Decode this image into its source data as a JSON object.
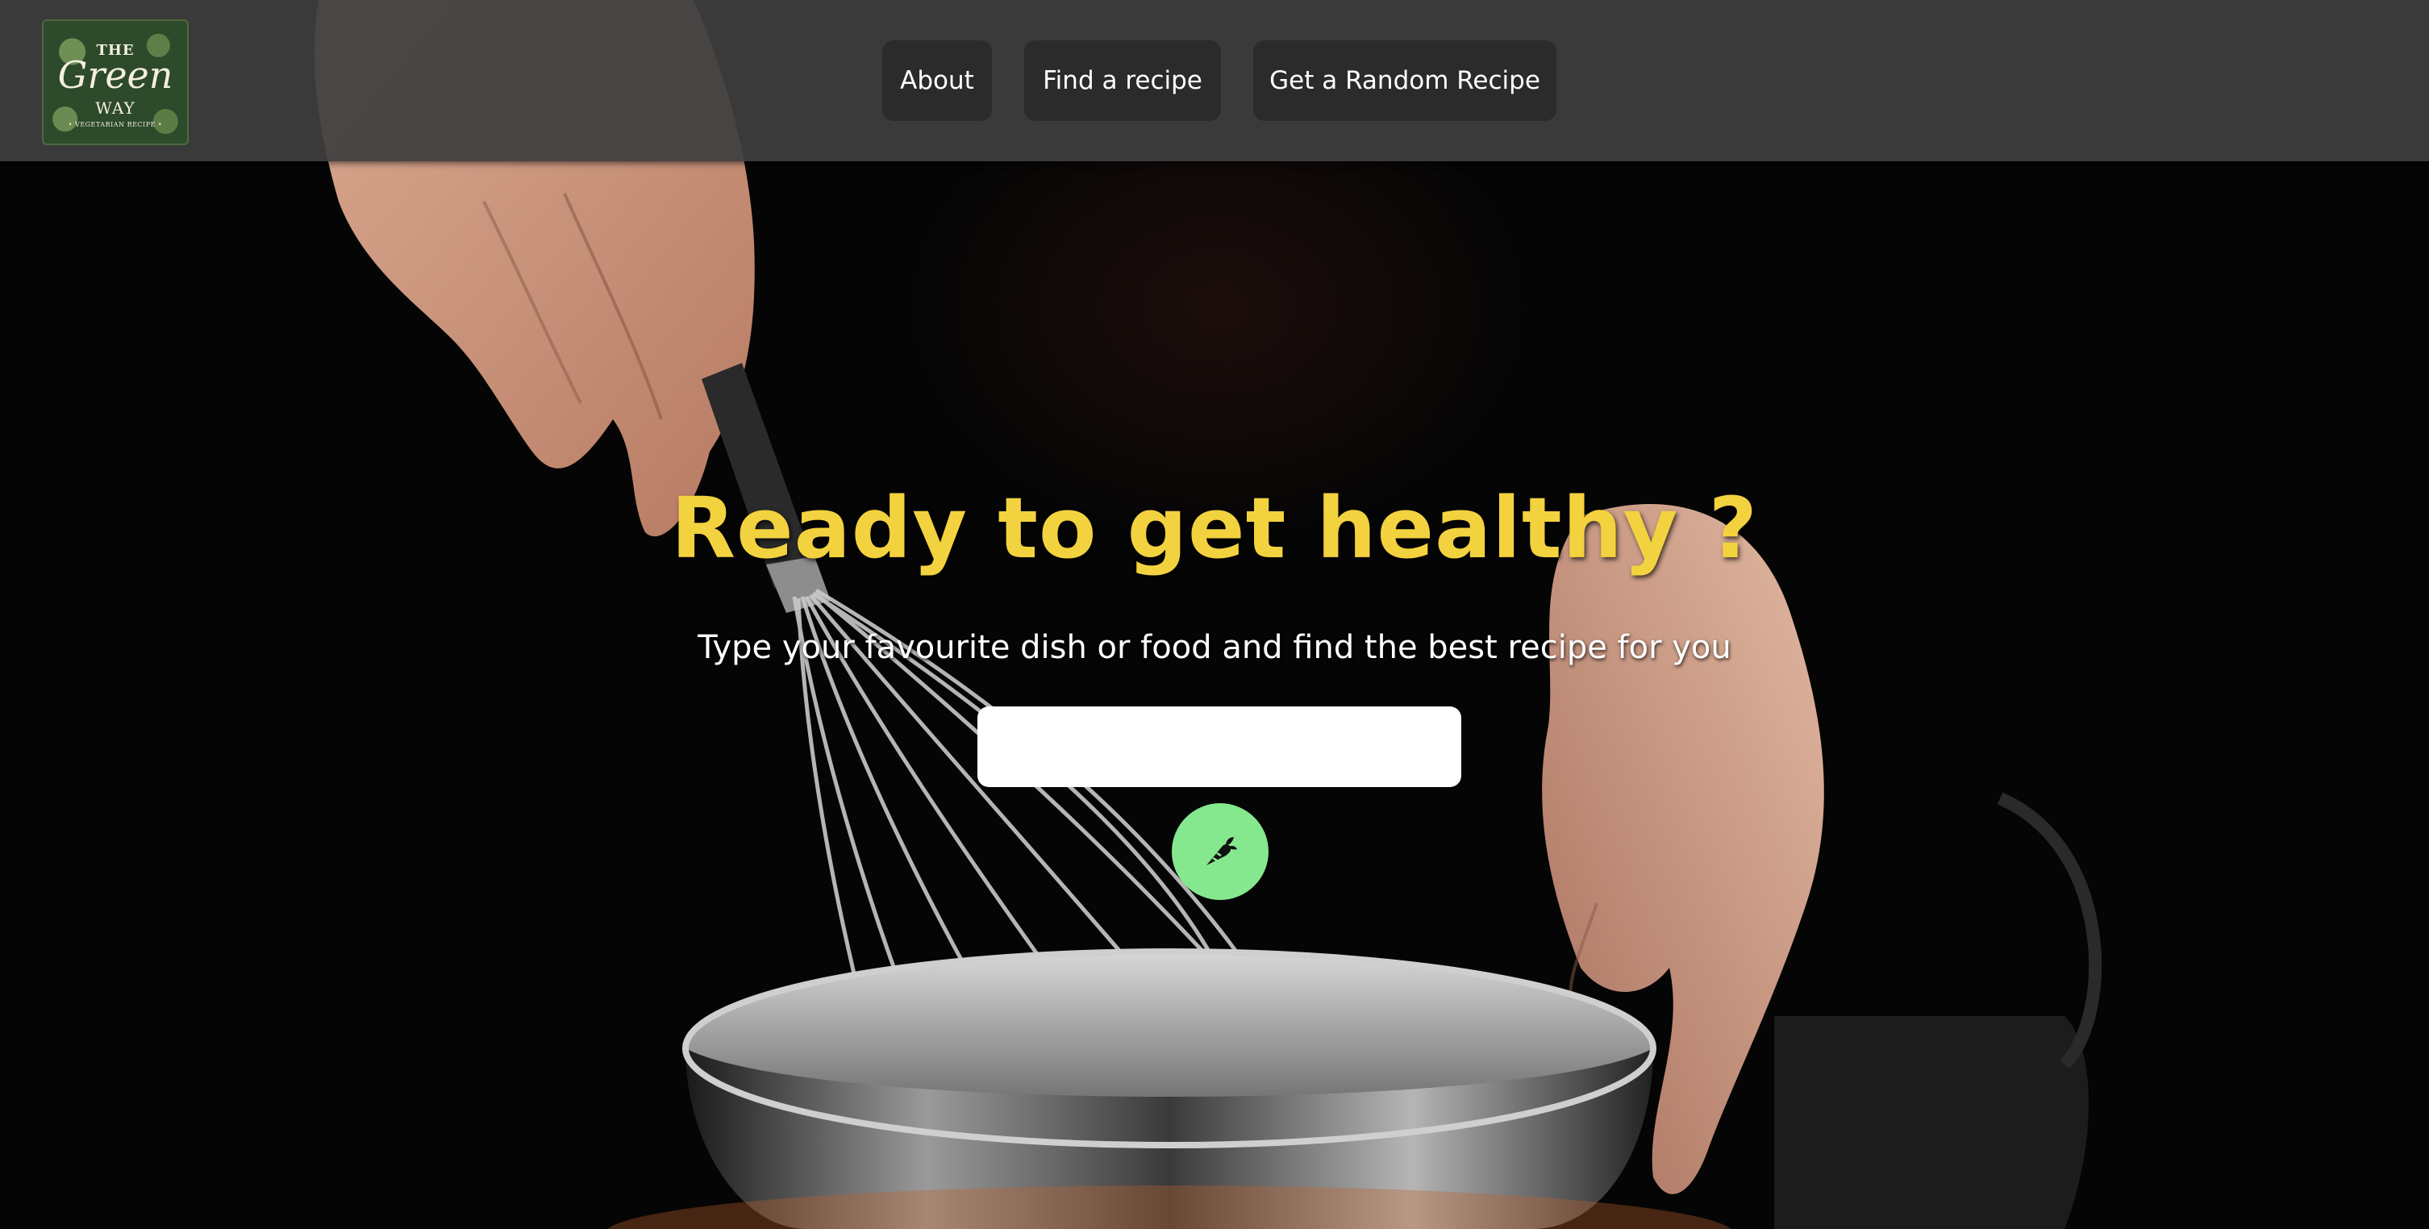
{
  "header": {
    "logo": {
      "line1": "THE",
      "line2": "Green",
      "line3": "WAY",
      "tagline": "• VEGETARIAN RECIPE •",
      "icon": "green-way-logo"
    },
    "nav": [
      {
        "label": "About"
      },
      {
        "label": "Find a recipe"
      },
      {
        "label": "Get a Random Recipe"
      }
    ]
  },
  "hero": {
    "title": "Ready to get healthy ?",
    "subtitle": "Type your favourite dish or food and find the best recipe for you",
    "search": {
      "value": "",
      "placeholder": ""
    },
    "submit_icon": "carrot-icon"
  },
  "colors": {
    "title": "#f3d23f",
    "search_button": "#86e88e",
    "navbar": "#3e3e3e",
    "nav_button": "#2b2b2b"
  }
}
